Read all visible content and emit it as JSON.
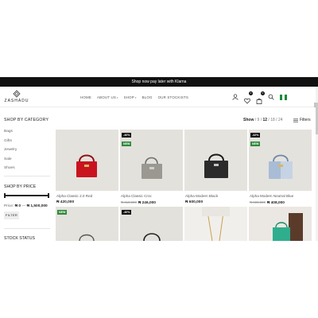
{
  "announcement": "Shop now pay later with Klarna",
  "brand": {
    "name": "ZASHADU"
  },
  "nav": [
    {
      "label": "HOME",
      "caret": false
    },
    {
      "label": "ABOUT US",
      "caret": true
    },
    {
      "label": "SHOP",
      "caret": true
    },
    {
      "label": "BLOG",
      "caret": false
    },
    {
      "label": "OUR STOCKISTS",
      "caret": false
    }
  ],
  "header_icons": {
    "wishlist_count": "0",
    "cart_count": "0",
    "flag_colors": [
      "#1a8a3a",
      "#ffffff",
      "#1a8a3a"
    ]
  },
  "toolbar": {
    "category_title": "SHOP BY CATEGORY",
    "show_label": "Show",
    "show_options": [
      "9",
      "12",
      "18",
      "24"
    ],
    "show_selected": "12",
    "filters_label": "Filters"
  },
  "sidebar": {
    "categories": [
      "Bags",
      "Gifts",
      "Jewelry",
      "Sale",
      "Shoes"
    ],
    "price_title": "SHOP BY PRICE",
    "price_label": "Price:",
    "price_min": "₦ 0",
    "price_sep": "—",
    "price_max": "₦ 1,500,000",
    "filter_button": "FILTER",
    "stock_title": "STOCK STATUS"
  },
  "products": [
    {
      "name": "Alpha Classic 2.0 Red",
      "old_price": "",
      "price": "₦ 420,000",
      "tags": [],
      "bag_color": "#c9141f"
    },
    {
      "name": "Alpha Classic Croc",
      "old_price": "₦ 410,000",
      "price": "₦ 246,000",
      "tags": [
        {
          "text": "-40%",
          "kind": "sale"
        },
        {
          "text": "NEW",
          "kind": "new"
        }
      ],
      "bag_color": "#9a9891"
    },
    {
      "name": "Alpha Modern Black",
      "old_price": "",
      "price": "₦ 600,000",
      "tags": [],
      "bag_color": "#2b2b2b"
    },
    {
      "name": "Alpha Modern Neutral Blue",
      "old_price": "₦ 600,000",
      "price": "₦ 408,000",
      "tags": [
        {
          "text": "-32%",
          "kind": "sale"
        },
        {
          "text": "NEW",
          "kind": "new"
        }
      ],
      "bag_color": "#a9bcd6"
    },
    {
      "name": "",
      "old_price": "",
      "price": "",
      "tags": [
        {
          "text": "NEW",
          "kind": "new"
        }
      ],
      "bag_color": ""
    },
    {
      "name": "",
      "old_price": "",
      "price": "",
      "tags": [
        {
          "text": "-40%",
          "kind": "sale"
        }
      ],
      "bag_color": ""
    },
    {
      "name": "",
      "old_price": "",
      "price": "",
      "tags": [],
      "bag_color": ""
    },
    {
      "name": "",
      "old_price": "",
      "price": "",
      "tags": [],
      "bag_color": "#2fae8e"
    }
  ]
}
